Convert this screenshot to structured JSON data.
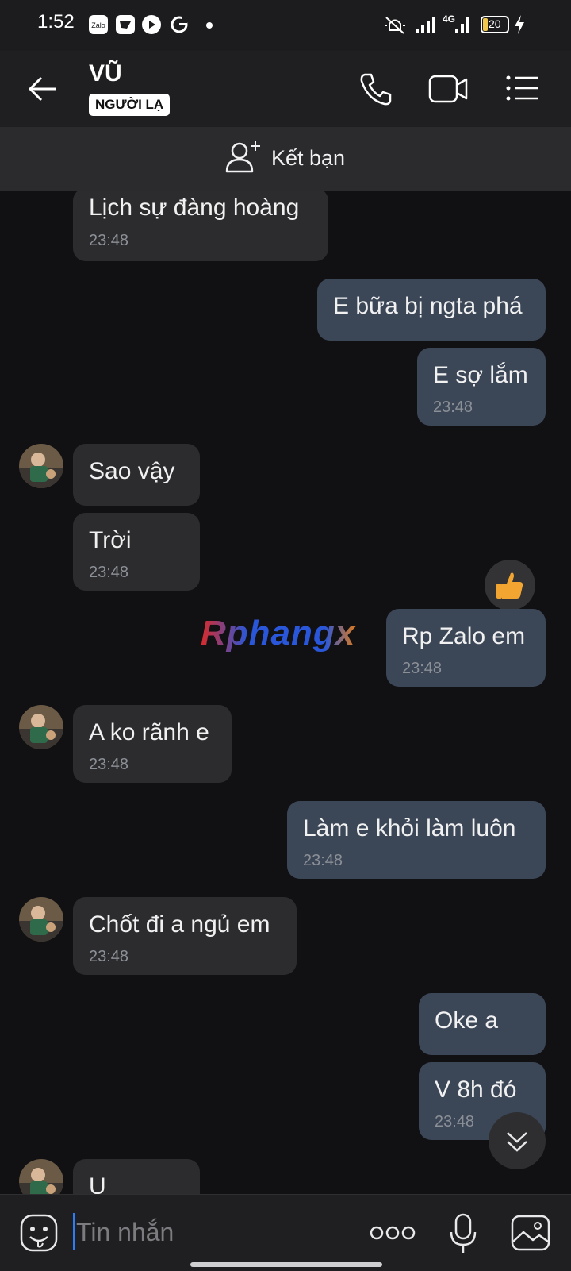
{
  "status_bar": {
    "time": "1:52",
    "battery": "20",
    "network": "4G"
  },
  "header": {
    "title": "VŨ",
    "badge": "NGƯỜI LẠ"
  },
  "friend_bar": {
    "label": "Kết bạn"
  },
  "messages": [
    {
      "dir": "in",
      "text": "Lịch sự đàng hoàng",
      "time": "23:48"
    },
    {
      "dir": "out",
      "text": "E bữa bị ngta phá",
      "time": ""
    },
    {
      "dir": "out",
      "text": "E sợ lắm",
      "time": "23:48"
    },
    {
      "dir": "in",
      "text": "Sao vậy",
      "time": ""
    },
    {
      "dir": "in",
      "text": "Trời",
      "time": "23:48"
    },
    {
      "dir": "out",
      "text": "Rp Zalo em",
      "time": "23:48"
    },
    {
      "dir": "in",
      "text": "A ko rãnh e",
      "time": "23:48"
    },
    {
      "dir": "out",
      "text": "Làm e khỏi làm luôn",
      "time": "23:48"
    },
    {
      "dir": "in",
      "text": "Chốt đi a ngủ em",
      "time": "23:48"
    },
    {
      "dir": "out",
      "text": "Oke a",
      "time": ""
    },
    {
      "dir": "out",
      "text": "V 8h đó",
      "time": "23:48"
    },
    {
      "dir": "in",
      "text": "U",
      "time": ""
    }
  ],
  "watermark": "Rphangx",
  "input": {
    "placeholder": "Tin nhắn"
  },
  "colors": {
    "bubble_in": "#2c2c2e",
    "bubble_out": "#3b4657",
    "caret": "#2e7cf6"
  }
}
